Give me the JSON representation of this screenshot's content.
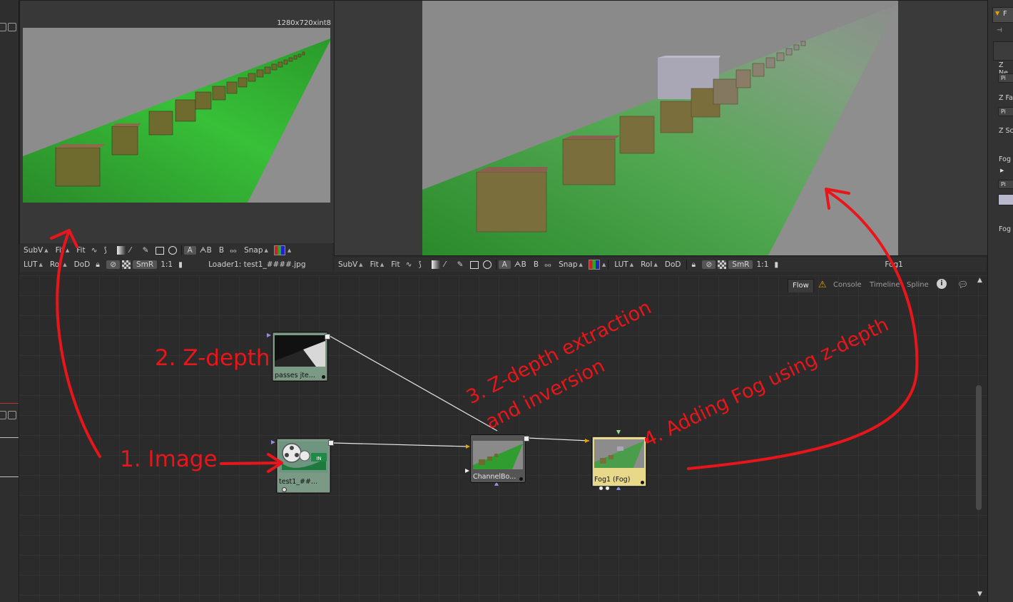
{
  "viewer_left": {
    "resolution": "1280x720xint8",
    "toolbar_top": [
      "SubV",
      "Fit",
      "Fit",
      "Snap"
    ],
    "toolbar_bottom": [
      "LUT",
      "RoI",
      "DoD",
      "SmR",
      "1:1"
    ],
    "source_label": "Loader1: test1_####.jpg"
  },
  "viewer_right": {
    "toolbar": [
      "SubV",
      "Fit",
      "Fit",
      "Snap",
      "LUT",
      "RoI",
      "DoD",
      "SmR",
      "1:1"
    ],
    "source_label": "Fog1"
  },
  "flow_tabs": [
    "Flow",
    "Console",
    "Timeline",
    "Spline"
  ],
  "right_panel": {
    "labels": [
      "Z Ne",
      "Z Fa",
      "Z Sc",
      "Fog",
      "Fog"
    ],
    "buttons": [
      "Pi",
      "Pi",
      "Pi"
    ],
    "header": "F"
  },
  "nodes": [
    {
      "id": "passes",
      "label": "passes jte..."
    },
    {
      "id": "loader",
      "label": "test1_##..."
    },
    {
      "id": "channel",
      "label": "ChannelBo..."
    },
    {
      "id": "fog",
      "label": "Fog1  (Fog)"
    }
  ],
  "annotations": {
    "a1": "1. Image",
    "a2": "2. Z-depth",
    "a3_line1": "3. Z-depth extraction",
    "a3_line2": "and inversion",
    "a4": "4. Adding Fog using z-depth"
  },
  "colors": {
    "annotation": "#e8161a",
    "node_green": "#7a9a86",
    "node_fog": "#e8d98a",
    "accent_yellow": "#e0a400"
  }
}
